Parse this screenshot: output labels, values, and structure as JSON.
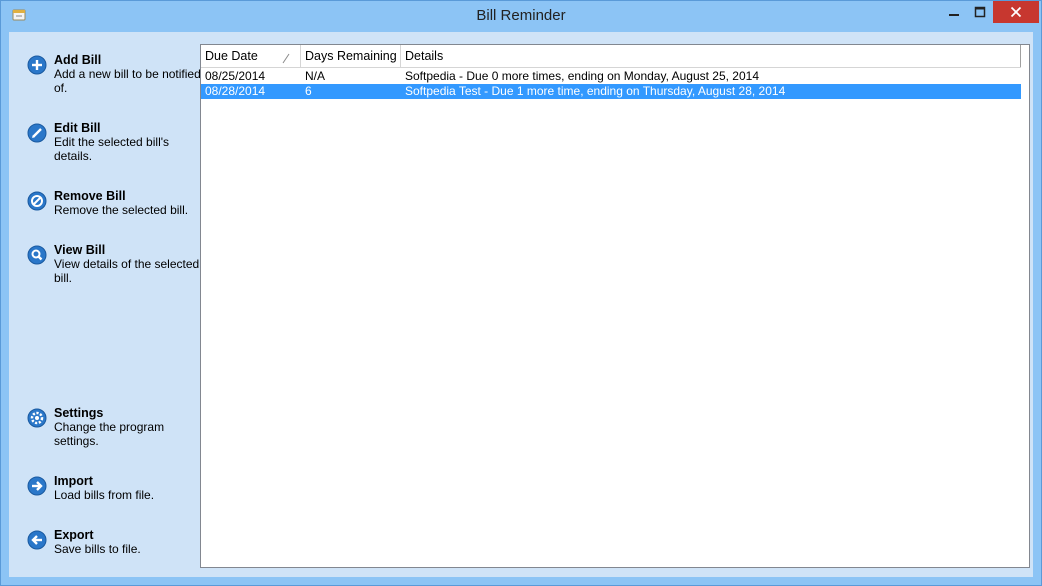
{
  "window": {
    "title": "Bill Reminder"
  },
  "sidebar": {
    "actions": [
      {
        "id": "add",
        "title": "Add Bill",
        "desc": "Add a new bill to be notified of.",
        "icon": "add-icon"
      },
      {
        "id": "edit",
        "title": "Edit Bill",
        "desc": "Edit the selected bill's details.",
        "icon": "edit-icon"
      },
      {
        "id": "remove",
        "title": "Remove Bill",
        "desc": "Remove the selected bill.",
        "icon": "remove-icon"
      },
      {
        "id": "view",
        "title": "View Bill",
        "desc": "View details of the selected bill.",
        "icon": "search-icon"
      },
      {
        "id": "settings",
        "title": "Settings",
        "desc": "Change the program settings.",
        "icon": "gear-icon"
      },
      {
        "id": "import",
        "title": "Import",
        "desc": "Load bills from file.",
        "icon": "arrow-right-icon"
      },
      {
        "id": "export",
        "title": "Export",
        "desc": "Save bills to file.",
        "icon": "arrow-left-icon"
      }
    ]
  },
  "list": {
    "columns": [
      "Due Date",
      "Days Remaining",
      "Details"
    ],
    "sorted_column": "Due Date",
    "rows": [
      {
        "due": "08/25/2014",
        "days": "N/A",
        "details": "Softpedia - Due 0 more times, ending on Monday, August 25, 2014",
        "selected": false
      },
      {
        "due": "08/28/2014",
        "days": "6",
        "details": "Softpedia Test - Due 1 more time, ending on Thursday, August 28, 2014",
        "selected": true
      }
    ]
  },
  "colors": {
    "title_bar": "#8cc4f5",
    "sidebar_bg": "#cfe3f7",
    "selection": "#3399ff",
    "close_button": "#c7372f",
    "icon_blue": "#2a77c9"
  }
}
